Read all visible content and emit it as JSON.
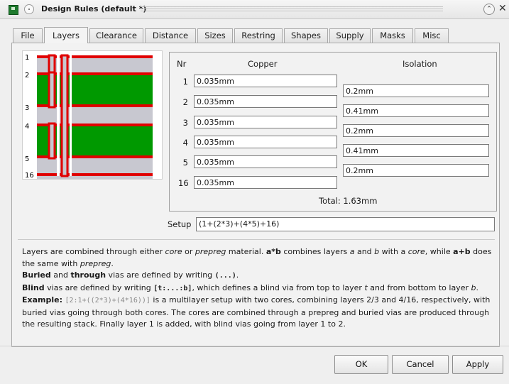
{
  "window": {
    "title": "Design Rules (default *)"
  },
  "tabs": [
    {
      "label": "File"
    },
    {
      "label": "Layers"
    },
    {
      "label": "Clearance"
    },
    {
      "label": "Distance"
    },
    {
      "label": "Sizes"
    },
    {
      "label": "Restring"
    },
    {
      "label": "Shapes"
    },
    {
      "label": "Supply"
    },
    {
      "label": "Masks"
    },
    {
      "label": "Misc"
    }
  ],
  "active_tab": "Layers",
  "stack_preview": {
    "layer_labels": [
      "1",
      "2",
      "3",
      "4",
      "5",
      "16"
    ],
    "colors": {
      "copper": "#e00000",
      "core": "#009900",
      "prepreg": "#c8c8d0"
    }
  },
  "layers_table": {
    "headers": {
      "nr": "Nr",
      "copper": "Copper",
      "isolation": "Isolation"
    },
    "rows": [
      {
        "nr": "1",
        "copper": "0.035mm"
      },
      {
        "nr": "2",
        "copper": "0.035mm"
      },
      {
        "nr": "3",
        "copper": "0.035mm"
      },
      {
        "nr": "4",
        "copper": "0.035mm"
      },
      {
        "nr": "5",
        "copper": "0.035mm"
      },
      {
        "nr": "16",
        "copper": "0.035mm"
      }
    ],
    "isolation": [
      "0.2mm",
      "0.41mm",
      "0.2mm",
      "0.41mm",
      "0.2mm"
    ],
    "total": "Total: 1.63mm"
  },
  "setup": {
    "label": "Setup",
    "value": "(1+(2*3)+(4*5)+16)"
  },
  "help": {
    "p1_a": "Layers are combined through either ",
    "p1_core": "core",
    "p1_b": " or ",
    "p1_prepreg": "prepreg",
    "p1_c": " material. ",
    "p1_axb": "a*b",
    "p1_d": " combines layers ",
    "p1_a_var": "a",
    "p1_e": " and ",
    "p1_b_var": "b",
    "p1_f": " with a ",
    "p1_core2": "core",
    "p1_g": ", while ",
    "p1_apb": "a+b",
    "p1_h": " does the same with ",
    "p1_prepreg2": "prepreg",
    "p1_i": ".",
    "p2_buried": "Buried",
    "p2_a": " and ",
    "p2_through": "through",
    "p2_b": " vias are defined by writing ",
    "p2_code": "(...)",
    "p2_c": ".",
    "p3_blind": "Blind",
    "p3_a": " vias are defined by writing ",
    "p3_code": "[t:...:b]",
    "p3_b": ", which defines a blind via from top to layer ",
    "p3_t": "t",
    "p3_c": " and from bottom to layer ",
    "p3_bv": "b",
    "p3_d": ".",
    "p4_example": "Example:",
    "p4_code": "[2:1+((2*3)+(4*16))]",
    "p4_text": " is a multilayer setup with two cores, combining layers 2/3 and 4/16, respectively, with buried vias going through both cores. The cores are combined through a prepreg and buried vias are produced through the resulting stack. Finally layer 1 is added, with blind vias going from layer 1 to 2."
  },
  "buttons": {
    "ok": "OK",
    "cancel": "Cancel",
    "apply": "Apply"
  }
}
